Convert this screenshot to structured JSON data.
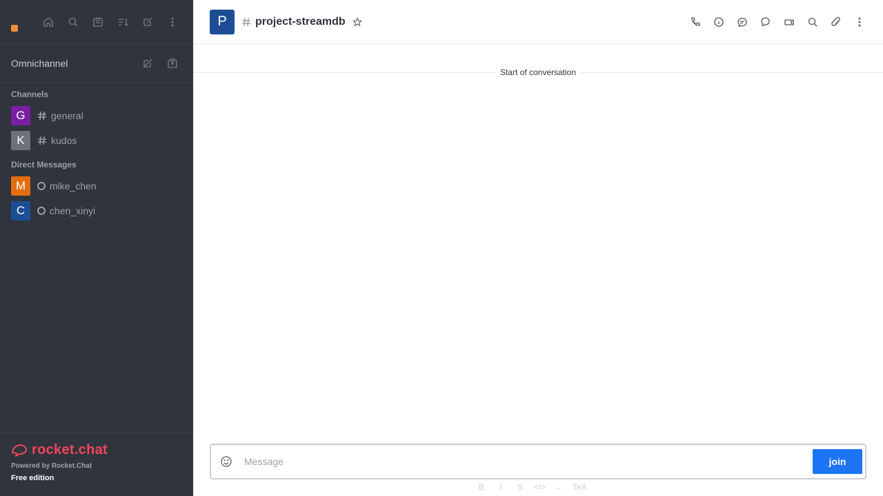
{
  "sidebar": {
    "user": {
      "status_color": "#f38c39"
    },
    "top_icons": [
      "home-icon",
      "search-icon",
      "directory-icon",
      "sort-icon",
      "create-new-icon",
      "more-icon"
    ],
    "omnichannel": {
      "label": "Omnichannel",
      "icons": [
        "contact-center-icon",
        "queue-icon"
      ]
    },
    "channels_title": "Channels",
    "channels": [
      {
        "initial": "G",
        "name": "general",
        "color": "#7a1fa2"
      },
      {
        "initial": "K",
        "name": "kudos",
        "color": "#6c727a"
      }
    ],
    "dm_title": "Direct Messages",
    "direct_messages": [
      {
        "initial": "M",
        "name": "mike_chen",
        "color": "#e26d0e"
      },
      {
        "initial": "C",
        "name": "chen_xinyi",
        "color": "#1d4e95"
      }
    ],
    "footer": {
      "logo_text": "rocket.chat",
      "powered_by": "Powered by Rocket.Chat",
      "edition": "Free edition"
    }
  },
  "header": {
    "room_initial": "P",
    "room_name": "project-streamdb",
    "actions": [
      "call-icon",
      "info-icon",
      "threads-icon",
      "discussions-icon",
      "members-icon",
      "search-messages-icon",
      "files-icon",
      "kebab-icon"
    ]
  },
  "conversation": {
    "start_label": "Start of conversation"
  },
  "composer": {
    "placeholder": "Message",
    "join_label": "join",
    "formatting": [
      "B",
      "I",
      "S",
      "</>",
      "←"
    ],
    "katex_label": "TeX"
  }
}
